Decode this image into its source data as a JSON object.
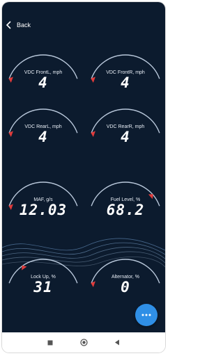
{
  "header": {
    "back_label": "Back"
  },
  "gauges": [
    {
      "label": "VDC FrontL, mph",
      "value": "4",
      "level": 0.0
    },
    {
      "label": "VDC FrontR, mph",
      "value": "4",
      "level": 0.0
    },
    {
      "label": "VDC RearL, mph",
      "value": "4",
      "level": 0.0
    },
    {
      "label": "VDC RearR, mph",
      "value": "4",
      "level": 0.0
    },
    {
      "label": "MAF, g/s",
      "value": "12.03",
      "level": 0.0
    },
    {
      "label": "Fuel Level, %",
      "value": "68.2",
      "level": 0.85
    },
    {
      "label": "Lock Up, %",
      "value": "31",
      "level": 0.25
    },
    {
      "label": "Alternator, %",
      "value": "0",
      "level": 0.0
    }
  ],
  "fab": {
    "icon": "more-horizontal-icon"
  },
  "nav": {
    "icons": [
      "square-icon",
      "circle-icon",
      "triangle-icon"
    ]
  },
  "colors": {
    "background": "#0c1b2e",
    "arc": "#b9c8db",
    "marker": "#e03b3b",
    "fab": "#2f8fe6"
  }
}
